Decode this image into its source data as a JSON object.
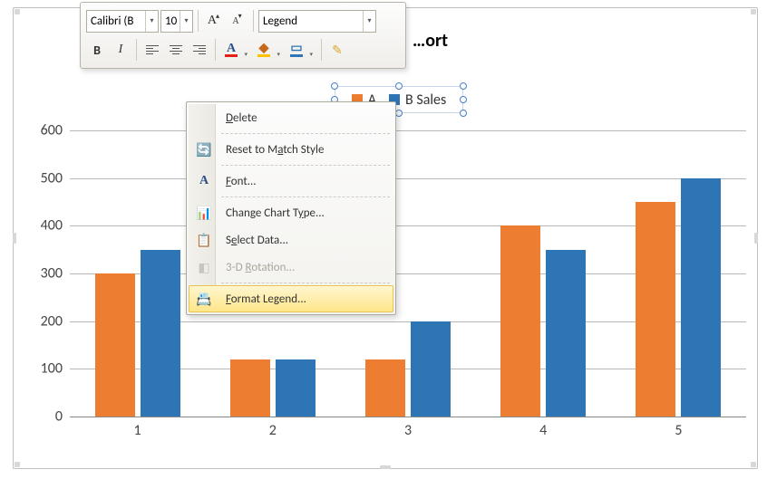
{
  "chart_data": {
    "type": "bar",
    "title": "…ort",
    "categories": [
      "1",
      "2",
      "3",
      "4",
      "5"
    ],
    "series": [
      {
        "name": "A",
        "color": "#ED7D31",
        "values": [
          300,
          120,
          120,
          400,
          450
        ]
      },
      {
        "name": "B Sales",
        "color": "#2E75B6",
        "values": [
          350,
          120,
          200,
          350,
          500
        ]
      }
    ],
    "ylim": [
      0,
      600
    ],
    "y_ticks": [
      0,
      100,
      200,
      300,
      400,
      500,
      600
    ],
    "grid": true
  },
  "toolbar": {
    "font_name": "Calibri (B",
    "font_size": "10",
    "increase_font_label": "A",
    "decrease_font_label": "A",
    "style_selector": "Legend",
    "bold": "B",
    "italic": "I",
    "font_color": "A",
    "fill_color": "◆",
    "border_color": "▭",
    "format_painter": "✎"
  },
  "context_menu": {
    "delete": "Delete",
    "reset": "Reset to Match Style",
    "font": "Font...",
    "change_type": "Change Chart Type...",
    "select_data": "Select Data...",
    "rotation_3d": "3-D Rotation...",
    "format_legend": "Format Legend..."
  }
}
